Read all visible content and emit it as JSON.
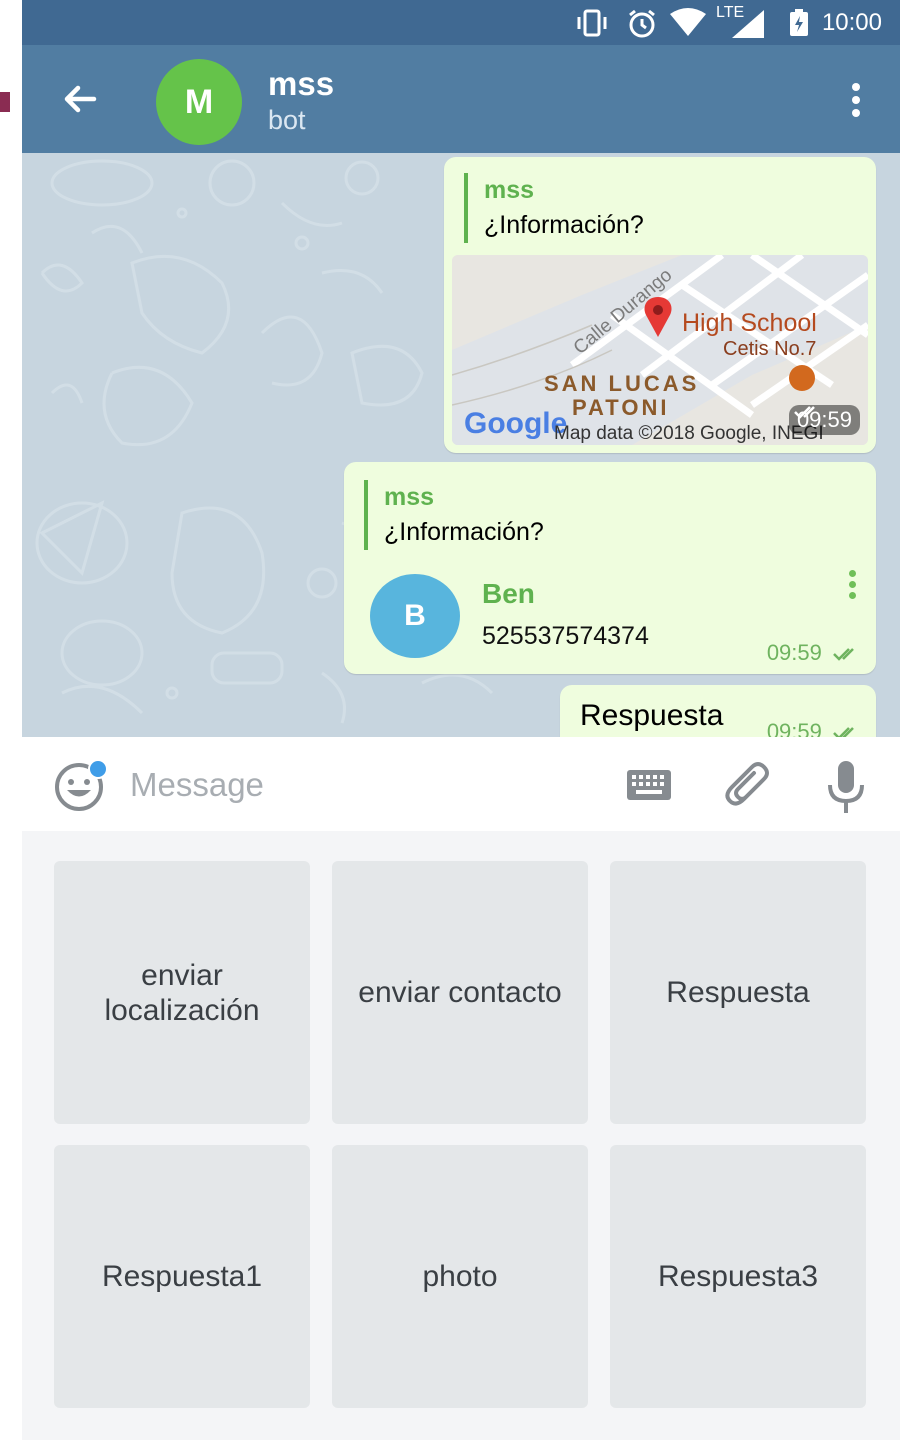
{
  "status_bar": {
    "network": "LTE",
    "time": "10:00"
  },
  "header": {
    "avatar_letter": "M",
    "title": "mss",
    "subtitle": "bot"
  },
  "messages": [
    {
      "type": "location",
      "reply_name": "mss",
      "reply_text": "¿Información?",
      "map_labels": [
        "Calle Durango",
        "High School",
        "Cetis No.7",
        "SAN LUCAS",
        "PATONI",
        "Google",
        "Map data ©2018 Google, INEGI"
      ],
      "time": "09:59"
    },
    {
      "type": "contact",
      "reply_name": "mss",
      "reply_text": "¿Información?",
      "contact_letter": "B",
      "contact_name": "Ben",
      "contact_phone": "525537574374",
      "time": "09:59"
    },
    {
      "type": "text",
      "text": "Respuesta",
      "time": "09:59"
    }
  ],
  "input": {
    "placeholder": "Message"
  },
  "keyboard": {
    "buttons": [
      [
        "enviar localización",
        "enviar contacto",
        "Respuesta"
      ],
      [
        "Respuesta1",
        "photo",
        "Respuesta3"
      ]
    ]
  },
  "colors": {
    "header": "#517da2",
    "status_bar": "#406992",
    "bubble": "#effdde",
    "accent_green": "#5fb24f",
    "bot_avatar": "#65c34a",
    "contact_avatar": "#58b5dd"
  }
}
